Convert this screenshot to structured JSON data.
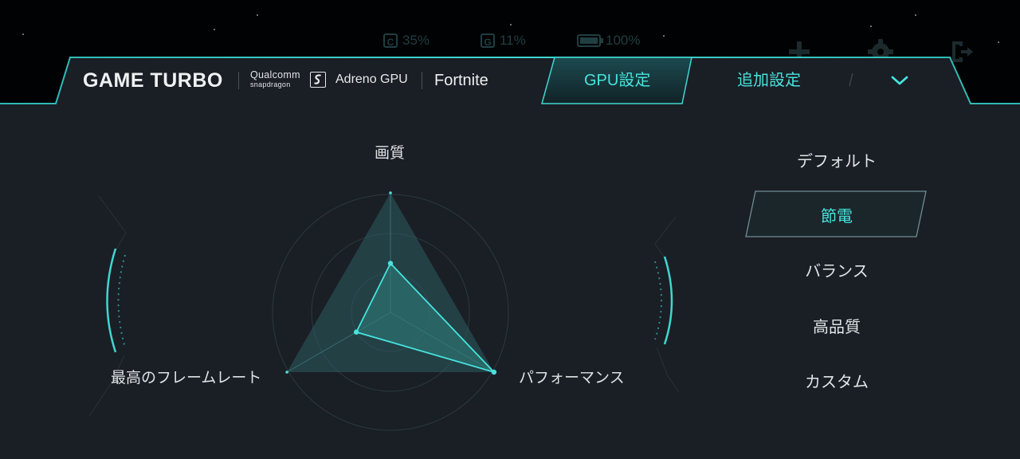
{
  "status_bar": {
    "cpu": {
      "letter": "C",
      "value": "35%"
    },
    "gpu": {
      "letter": "G",
      "value": "11%"
    },
    "battery": {
      "value": "100%"
    }
  },
  "header": {
    "brand": "GAME TURBO",
    "chip_brand_line1": "Qualcomm",
    "chip_brand_line2": "snapdragon",
    "gpu_name": "Adreno GPU",
    "game_name": "Fortnite"
  },
  "tabs": [
    {
      "label": "GPU設定",
      "active": true
    },
    {
      "label": "追加設定",
      "active": false
    }
  ],
  "icons": {
    "add": "plus-icon",
    "settings": "gear-icon",
    "exit": "exit-icon",
    "expand": "chevron-down-icon"
  },
  "radar": {
    "axes": [
      {
        "label": "画質"
      },
      {
        "label": "パフォーマンス"
      },
      {
        "label": "最高のフレームレート"
      }
    ],
    "max_values": [
      1.0,
      1.0,
      1.0
    ],
    "current_values": [
      0.41,
      1.0,
      0.33
    ]
  },
  "presets": [
    {
      "label": "デフォルト",
      "selected": false
    },
    {
      "label": "節電",
      "selected": true
    },
    {
      "label": "バランス",
      "selected": false
    },
    {
      "label": "高品質",
      "selected": false
    },
    {
      "label": "カスタム",
      "selected": false
    }
  ],
  "colors": {
    "accent": "#47e3dd",
    "panel": "#1a1e25",
    "dim_status": "#1f3f43"
  }
}
